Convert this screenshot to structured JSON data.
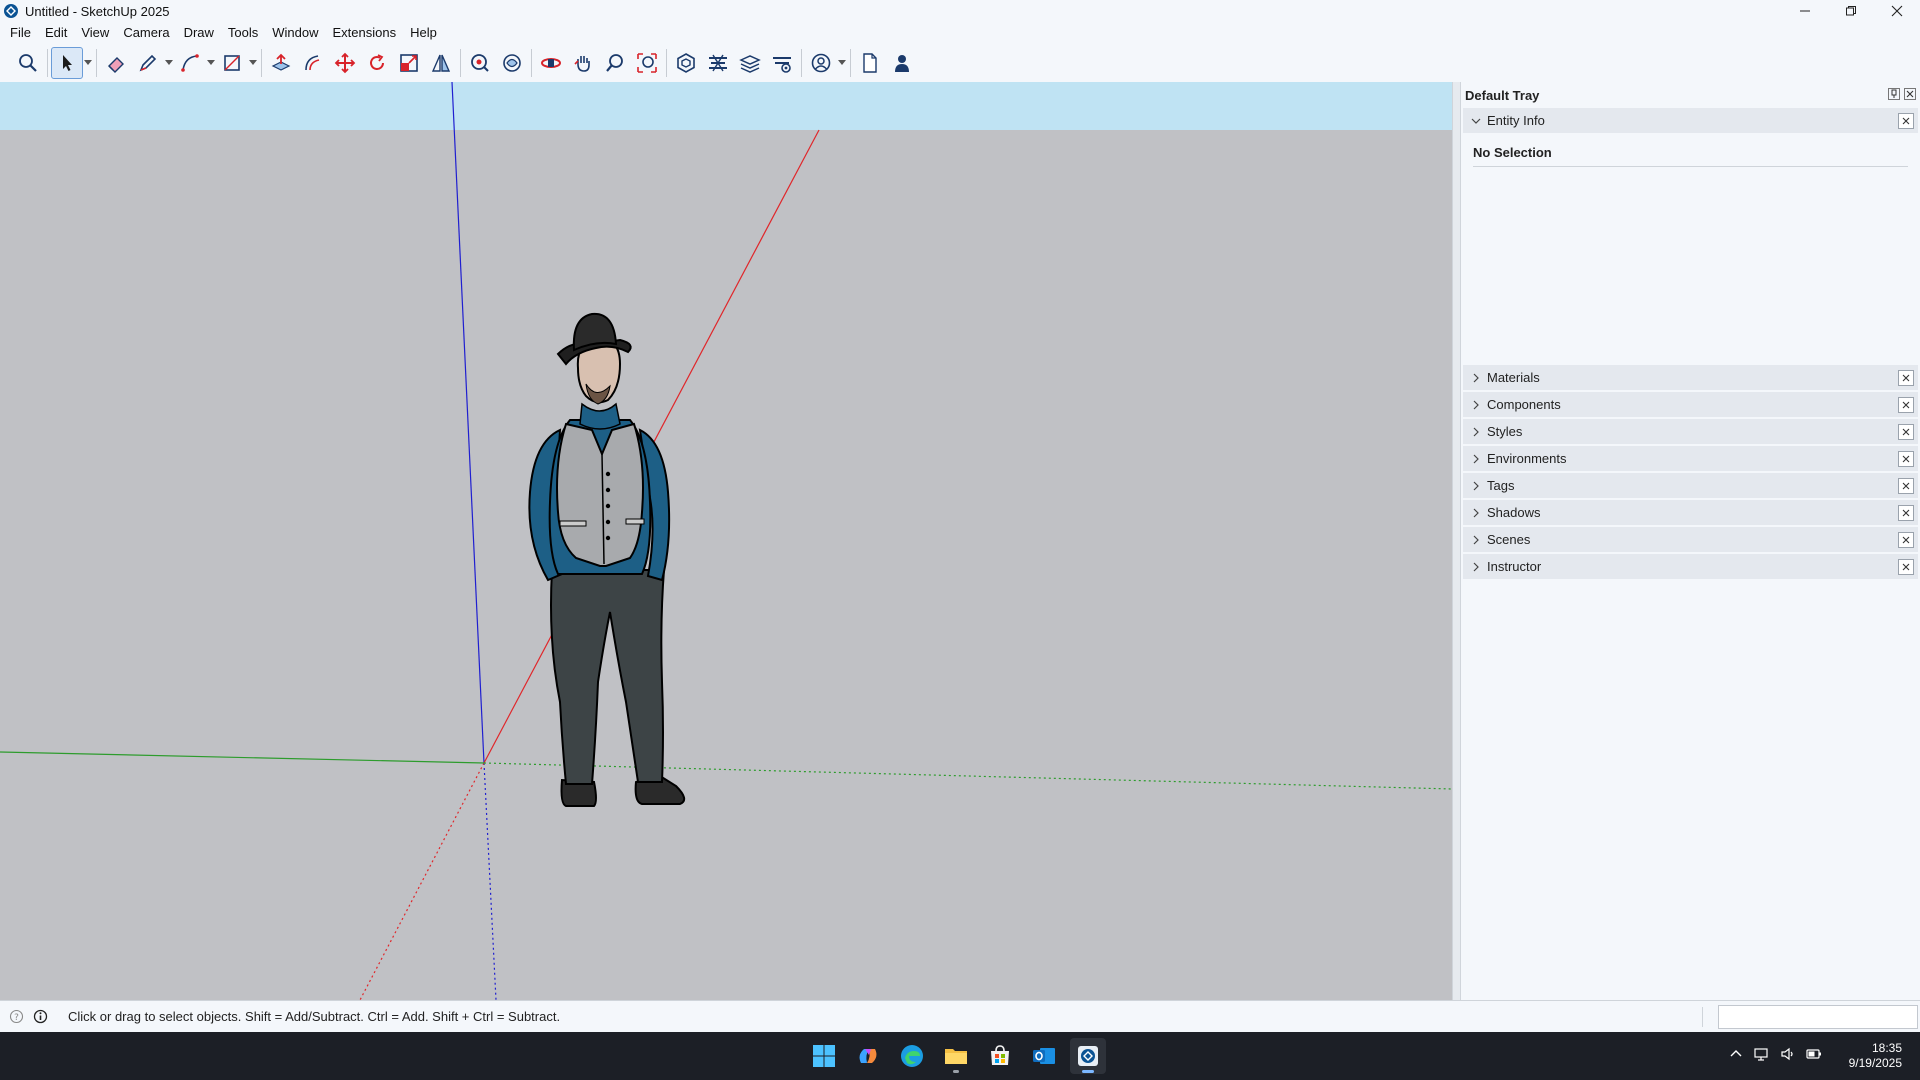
{
  "window": {
    "title": "Untitled - SketchUp 2025"
  },
  "menu": {
    "items": [
      "File",
      "Edit",
      "View",
      "Camera",
      "Draw",
      "Tools",
      "Window",
      "Extensions",
      "Help"
    ]
  },
  "toolbar": {
    "tools": [
      "search-icon",
      "select-icon",
      "eraser-icon",
      "pencil-icon",
      "line-icon",
      "rectangle-icon",
      "push-pull-icon",
      "offset-icon",
      "move-icon",
      "rotate-icon",
      "scale-icon",
      "follow-me-icon",
      "tape-measure-icon",
      "paint-bucket-icon",
      "orbit-icon",
      "pan-icon",
      "zoom-icon",
      "zoom-extents-icon",
      "warehouse-icon",
      "extension-warehouse-icon",
      "layout-icon",
      "extension-manager-icon",
      "account-icon",
      "new-file-icon",
      "user-icon"
    ]
  },
  "tray": {
    "title": "Default Tray",
    "entity_info": {
      "label": "Entity Info",
      "selection": "No Selection"
    },
    "panels": [
      "Materials",
      "Components",
      "Styles",
      "Environments",
      "Tags",
      "Shadows",
      "Scenes",
      "Instructor"
    ]
  },
  "statusbar": {
    "message": "Click or drag to select objects. Shift = Add/Subtract. Ctrl = Add. Shift + Ctrl = Subtract."
  },
  "taskbar": {
    "apps": [
      "windows-start-icon",
      "copilot-icon",
      "edge-icon",
      "file-explorer-icon",
      "store-icon",
      "outlook-icon",
      "sketchup-icon"
    ],
    "time": "18:35",
    "date": "9/19/2025"
  },
  "colors": {
    "sky": "#bfe3f3",
    "ground": "#c0c1c5",
    "axis_red": "#e0262a",
    "axis_green": "#2d9c2d",
    "axis_blue": "#1f1fd0"
  }
}
